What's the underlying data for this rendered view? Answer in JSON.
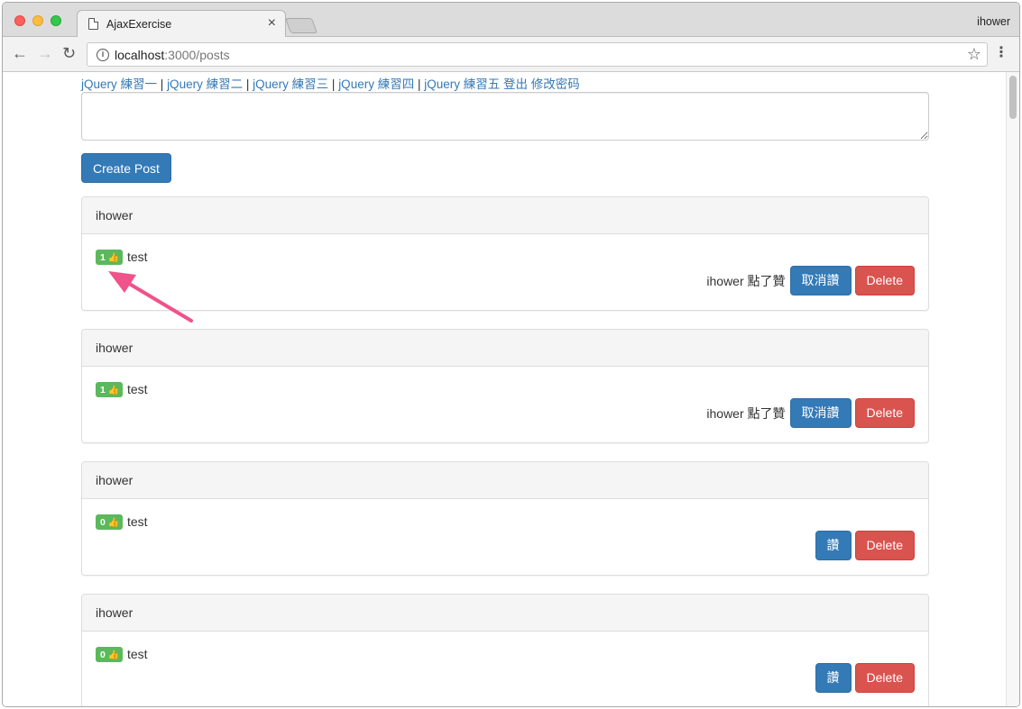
{
  "browser": {
    "tab_title": "AjaxExercise",
    "tab_close": "×",
    "profile_name": "ihower",
    "url_host": "localhost",
    "url_path": ":3000/posts",
    "back_glyph": "←",
    "forward_glyph": "→",
    "reload_glyph": "↻",
    "info_glyph": "i",
    "bookmark_glyph": "☆",
    "menu_glyph": "⋮"
  },
  "nav": {
    "links": [
      "jQuery 練習一",
      "jQuery 練習二",
      "jQuery 練習三",
      "jQuery 練習四",
      "jQuery 練習五"
    ],
    "separator": "|",
    "logout": "登出",
    "change_password": "修改密码"
  },
  "form": {
    "textarea_value": "",
    "create_button": "Create Post"
  },
  "posts": [
    {
      "author": "ihower",
      "likes": "1",
      "thumb": "👍",
      "text": "test",
      "liked_text": "ihower 點了贊",
      "like_button": "取消讚",
      "delete_button": "Delete"
    },
    {
      "author": "ihower",
      "likes": "1",
      "thumb": "👍",
      "text": "test",
      "liked_text": "ihower 點了贊",
      "like_button": "取消讚",
      "delete_button": "Delete"
    },
    {
      "author": "ihower",
      "likes": "0",
      "thumb": "👍",
      "text": "test",
      "liked_text": "",
      "like_button": "讚",
      "delete_button": "Delete"
    },
    {
      "author": "ihower",
      "likes": "0",
      "thumb": "👍",
      "text": "test",
      "liked_text": "",
      "like_button": "讚",
      "delete_button": "Delete"
    }
  ],
  "colors": {
    "primary": "#337ab7",
    "danger": "#d9534f",
    "success": "#5cb85c",
    "annotation_arrow": "#f0528a"
  }
}
